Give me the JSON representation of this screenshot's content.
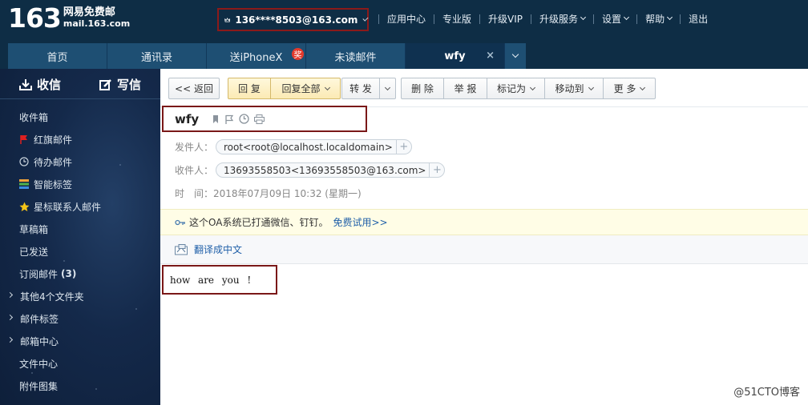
{
  "header": {
    "logo_number": "163",
    "logo_cn": "网易免费邮",
    "logo_domain": "mail.163.com",
    "account": "136****8503@163.com",
    "nav": [
      {
        "label": "应用中心",
        "dropdown": false
      },
      {
        "label": "专业版",
        "dropdown": false
      },
      {
        "label": "升级VIP",
        "dropdown": false
      },
      {
        "label": "升级服务",
        "dropdown": true
      },
      {
        "label": "设置",
        "dropdown": true
      },
      {
        "label": "帮助",
        "dropdown": true
      },
      {
        "label": "退出",
        "dropdown": false
      }
    ]
  },
  "tabs": [
    {
      "label": "首页"
    },
    {
      "label": "通讯录"
    },
    {
      "label": "送iPhoneX",
      "badge": "奖"
    },
    {
      "label": "未读邮件"
    },
    {
      "label": "wfy",
      "close": "×"
    }
  ],
  "sidebar": {
    "receive_label": "收信",
    "compose_label": "写信",
    "folders": [
      {
        "label": "收件箱"
      },
      {
        "label": "红旗邮件",
        "icon": "red-flag-icon"
      },
      {
        "label": "待办邮件",
        "icon": "clock-icon"
      },
      {
        "label": "智能标签",
        "icon": "tag-stack-icon"
      },
      {
        "label": "星标联系人邮件",
        "icon": "star-icon"
      },
      {
        "label": "草稿箱"
      },
      {
        "label": "已发送"
      },
      {
        "label": "订阅邮件",
        "count": "(3)"
      },
      {
        "label": "其他4个文件夹",
        "expand": true
      },
      {
        "label": "邮件标签",
        "expand": true
      },
      {
        "label": "邮箱中心",
        "expand": true
      },
      {
        "label": "文件中心"
      },
      {
        "label": "附件图集"
      }
    ]
  },
  "toolbar": {
    "back": "<< 返回",
    "reply": "回 复",
    "reply_all": "回复全部",
    "forward": "转 发",
    "delete": "删 除",
    "report": "举 报",
    "mark_as": "标记为",
    "move_to": "移动到",
    "more": "更 多"
  },
  "email": {
    "subject": "wfy",
    "from_label": "发件人：",
    "from": "root<root@localhost.localdomain>",
    "to_label": "收件人：",
    "to": "13693558503<13693558503@163.com>",
    "time_label": "时　间：",
    "time": "2018年07月09日 10:32 (星期一)",
    "body": "how are you !"
  },
  "notice": {
    "text": "这个OA系统已打通微信、钉钉。",
    "link": "免费试用>>"
  },
  "translate_label": "翻译成中文",
  "watermark": "@51CTO博客",
  "colors": {
    "topbar": "#0e2d45",
    "tab": "#1e4f73",
    "highlight_box": "#7a1818",
    "link": "#1f5fa8"
  }
}
